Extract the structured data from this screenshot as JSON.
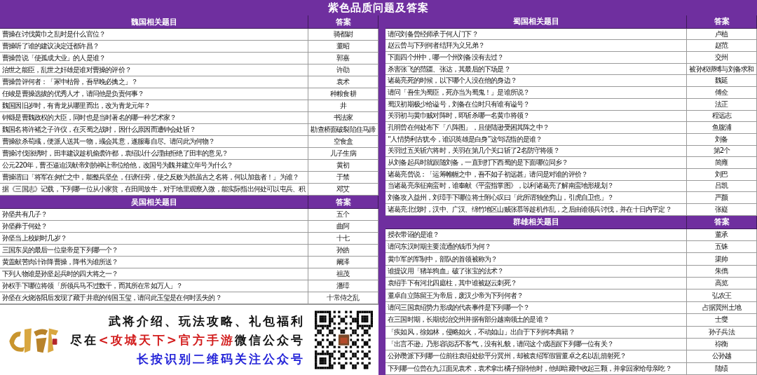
{
  "title": "紫色品质问题及答案",
  "left_column": {
    "tables": [
      {
        "header": {
          "question": "魏国相关题目",
          "answer": "答案"
        },
        "rows": [
          {
            "question": "曹操在讨伐黄巾之乱时是什么官位？",
            "answer": "骑都尉"
          },
          {
            "question": "曹操听了谁的建议决定迁都许昌？",
            "answer": "董昭"
          },
          {
            "question": "曹操曾说「使孤成大业」的人是谁？",
            "answer": "郭嘉"
          },
          {
            "question": "治世之能臣，乱世之奸雄是谁对曹操的评价？",
            "answer": "许劭"
          },
          {
            "question": "曹操曾评何者：「冢中枯骨，吾早晚必擒之」？",
            "answer": "袁术"
          },
          {
            "question": "任峻是曹操选拔的优秀人才，请问他是负责何事？",
            "answer": "种粮食耕"
          },
          {
            "question": "魏国因旧岁时，有青龙从哪里而出，改为青龙元年？",
            "answer": "井"
          },
          {
            "question": "钟繇是曹魏政权的大臣，同时也是当时著名的哪一种艺术家？",
            "answer": "书法家"
          },
          {
            "question": "魏国名将许褚之子许仪，在灭蜀之战时，因什么原因而遭钟会处斩？",
            "answer": "勘查桥面破裂陷住马蹄"
          },
          {
            "question": "曹操欲杀荀彧，便派人送其一物，彧会其意，遂服毒自尽。请问此为何物？",
            "answer": "空食盒"
          },
          {
            "question": "曹操讨伐张绣时，田丰建议趁机偷袭许都，袁绍以什么理由拒绝了田丰的意见？",
            "answer": "儿子生病"
          },
          {
            "question": "公元220年，曹丕逼迫汉献帝刘协禅让帝位给他，改国号为魏并建立年号为什么？",
            "answer": "黄初"
          },
          {
            "question": "曹操谓曰「将军在匆忙之中，能整兵坚垒，任谤任劳，使之反败为胜虽古之名将，何以加兹者！」为谁？",
            "answer": "于禁"
          },
          {
            "question": "据《三国志》记载，下列哪一位从小家贫，在田间放牛，对于地里观察入微，能实际指出何处可以屯兵、积",
            "answer": "邓艾"
          }
        ]
      },
      {
        "header": {
          "question": "吴国相关题目",
          "answer": "答案"
        },
        "rows": [
          {
            "question": "孙坚共有几子？",
            "answer": "五个"
          },
          {
            "question": "孙坚葬于何处？",
            "answer": "曲阿"
          },
          {
            "question": "孙坚当上校尉时几岁？",
            "answer": "十七"
          },
          {
            "question": "三国东吴的最后一位皇帝是下列哪一个？",
            "answer": "孙皓"
          },
          {
            "question": "黄盖献苦肉计诈降曹操，降书为谁所送？",
            "answer": "阚泽"
          },
          {
            "question": "下列人物谁是孙坚起兵时的四大将之一？",
            "answer": "祖茂"
          },
          {
            "question": "孙权手下哪位将领「所领兵马不过数千，而其所在常如万人」？",
            "answer": "潘璋"
          },
          {
            "question": "孙坚在火烧洛阳后发现了藏于井底的传国玉玺，请问此玉玺是在何时丢失的？",
            "answer": "十常侍之乱"
          }
        ]
      }
    ],
    "banner": {
      "line_1": "武将介绍、玩法攻略、礼包福利",
      "line_2": [
        {
          "text": "尽在",
          "highlight": false
        },
        {
          "text": "<攻城天下>官方手游",
          "highlight": true
        },
        {
          "text": "微信公众号",
          "highlight": false
        }
      ],
      "line_3": "长按识别二维码关注公众号"
    }
  },
  "right_column": {
    "tables": [
      {
        "header": {
          "question": "蜀国相关题目",
          "answer": "答案"
        },
        "rows": [
          {
            "question": "请问刘备曾经师承于何人门下？",
            "answer": "卢植"
          },
          {
            "question": "赵云曾与下列何者结拜为义兄弟？",
            "answer": "赵范"
          },
          {
            "question": "下面四个州中，哪一个州刘备没有去过？",
            "answer": "交州"
          },
          {
            "question": "杀害张飞的范疆、张达，其最后的下场是？",
            "answer": "被孙权绑缚与刘备求和"
          },
          {
            "question": "诸葛亮死的时候，以下哪个人没在他的身边？",
            "answer": "魏延"
          },
          {
            "question": "请问「吾生为蜀臣，死亦当为蜀鬼！」是谁所说？",
            "answer": "傅佥"
          },
          {
            "question": "蜀汉初期极少给谥号，刘备在位时只有谁有谥号？",
            "answer": "法正"
          },
          {
            "question": "关羽初与黄巾贼对阵时，即斩杀哪一名黄巾将领？",
            "answer": "程远志"
          },
          {
            "question": "孔明曾在何处布下「八阵图」，且使陆逊受困其阵之中？",
            "answer": "鱼腹浦"
          },
          {
            "question": "“人情势利古犹今，谁识英雄是白身”这句话指的是谁？",
            "answer": "刘备"
          },
          {
            "question": "关羽过五关斩六将时，关羽在第几个关口斩了2名防守将领？",
            "answer": "第2个"
          },
          {
            "question": "从刘备起兵时就跟随刘备，一直到打下西蜀的是下面哪位同乡？",
            "answer": "简雍"
          },
          {
            "question": "诸葛亮曾说：「运筹帷幄之中，吾不如子初远甚」请问是对谁的评价？",
            "answer": "刘巴"
          },
          {
            "question": "当诸葛亮亲征南蛮时，谁奉献《平蛮指掌图》，以利诸葛亮了解南蛮地形规划？",
            "answer": "吕凯"
          },
          {
            "question": "刘备攻入益州，刘璋手下哪位将士附心叹曰「此所谓独坐穷山，引虎自卫也」？",
            "answer": "严颜"
          },
          {
            "question": "诸葛亮北伐时，汉中、广汉、绵竹地区山贼张慕等趁机作乱，之后由谁领兵讨伐，并在十日内平定？",
            "answer": "张嶷"
          }
        ]
      },
      {
        "header": {
          "question": "群雄相关题目",
          "answer": "答案"
        },
        "rows": [
          {
            "question": "授衣带诏的是谁？",
            "answer": "董承"
          },
          {
            "question": "请问东汉时期主要流通的钱币为何？",
            "answer": "五铢"
          },
          {
            "question": "黄巾军的军制中，部队的首领被称为？",
            "answer": "渠帅"
          },
          {
            "question": "谁提议用「猪羊狗血」破了张宝的法术？",
            "answer": "朱儁"
          },
          {
            "question": "袁绍手下有河北四庭柱，其中谁被赵云刺死？",
            "answer": "高览"
          },
          {
            "question": "董卓自立陈留王为帝后，废汉少帝为下列何者？",
            "answer": "弘农王"
          },
          {
            "question": "请问三国袁绍势力形成的代表事件是下列哪一个？",
            "answer": "占据冀州土地"
          },
          {
            "question": "在三国时期，长期统治交州并据有部分越南领土的是谁？",
            "answer": "士燮"
          },
          {
            "question": "「疾如风，徐如林，侵略如火，不动如山」出自于下列何本典籍？",
            "answer": "孙子兵法"
          },
          {
            "question": "「出言不逊」乃形容说话不客气，没有礼貌，请问这个成语跟下列哪一位有关？",
            "answer": "祢衡"
          },
          {
            "question": "公孙瓒派下列哪一位前往袁绍处欲平分冀州，却被袁绍军假冒董卓之名以乱箭射死？",
            "answer": "公孙越"
          },
          {
            "question": "下列哪一位曾在九江面见袁术，袁术拿出橘子招待他时，他却暗藏中收起三颗，并拿回家给母亲吃？",
            "answer": "陆绩"
          }
        ]
      }
    ]
  }
}
